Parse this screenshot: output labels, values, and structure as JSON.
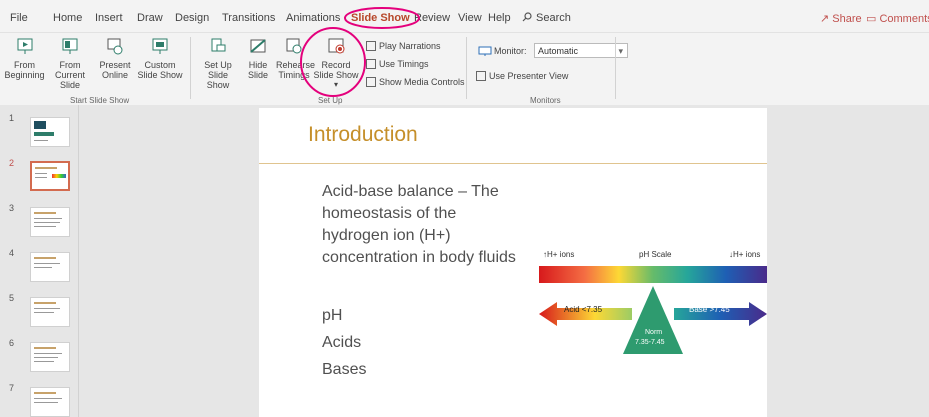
{
  "tabs": [
    "File",
    "Home",
    "Insert",
    "Draw",
    "Design",
    "Transitions",
    "Animations",
    "Slide Show",
    "Review",
    "View",
    "Help"
  ],
  "search_label": "Search",
  "share_label": "Share",
  "comments_label": "Comments",
  "ribbon": {
    "from_beginning": "From Beginning",
    "from_current": "From Current Slide",
    "present_online": "Present Online",
    "custom_show": "Custom Slide Show",
    "start_group": "Start Slide Show",
    "setup_show": "Set Up Slide Show",
    "hide_slide": "Hide Slide",
    "rehearse": "Rehearse Timings",
    "record_show": "Record Slide Show",
    "setup_group": "Set Up",
    "play_narrations": "Play Narrations",
    "use_timings": "Use Timings",
    "show_media": "Show Media Controls",
    "monitor_label": "Monitor:",
    "monitor_value": "Automatic",
    "use_presenter": "Use Presenter View",
    "monitors_group": "Monitors"
  },
  "thumb_numbers": [
    "1",
    "2",
    "3",
    "4",
    "5",
    "6",
    "7"
  ],
  "slide": {
    "title": "Introduction",
    "bullets": [
      "Acid-base balance – The homeostasis of the hydrogen ion (H+) concentration in body fluids",
      "pH",
      "Acids",
      "Bases"
    ],
    "ph_left": "↑H+ ions",
    "ph_center": "pH Scale",
    "ph_right": "↓H+ ions",
    "acid_label": "Acid <7.35",
    "base_label": "Base >7.45",
    "norm_label": "Norm",
    "norm_range": "7.35-7.45"
  },
  "colors": {
    "accent": "#b7472a",
    "annotation": "#e4007c",
    "title": "#c58f2a"
  }
}
